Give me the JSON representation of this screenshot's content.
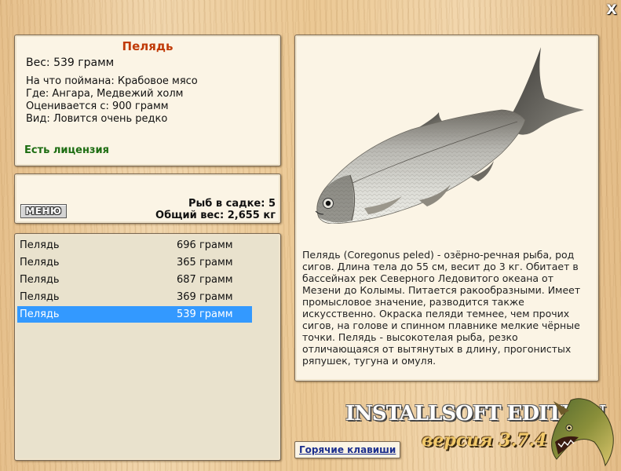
{
  "window": {
    "close_label": "X"
  },
  "fish_info": {
    "title": "Пелядь",
    "weight": "Вес: 539 грамм",
    "lines": [
      "На что поймана: Крабовое мясо",
      "Где: Ангара, Медвежий холм",
      "Оценивается с: 900 грамм",
      "Вид: Ловится очень редко"
    ],
    "license": "Есть лицензия",
    "license_color": "#1d6d12",
    "title_color": "#c03a08"
  },
  "keepnet": {
    "menu_label": "МЕНЮ",
    "count": "Рыб в садке: 5",
    "total": "Общий вес: 2,655 кг"
  },
  "catch_list": [
    {
      "name": "Пелядь",
      "weight": "696 грамм",
      "selected": false
    },
    {
      "name": "Пелядь",
      "weight": "365 грамм",
      "selected": false
    },
    {
      "name": "Пелядь",
      "weight": "687 грамм",
      "selected": false
    },
    {
      "name": "Пелядь",
      "weight": "369 грамм",
      "selected": false
    },
    {
      "name": "Пелядь",
      "weight": "539 грамм",
      "selected": true
    }
  ],
  "selection_color": "#3399ff",
  "description": "Пелядь (Coregonus peled) - озёрно-речная рыба, род сигов. Длина тела до 55 см, весит до 3 кг. Обитает в бассейнах рек Северного Ледовитого океана от Мезени до Колымы. Питается ракообразными. Имеет промысловое значение, разводится также искусственно. Окраска пеляди темнее, чем прочих сигов, на голове и спинном плавнике мелкие чёрные точки. Пелядь - высокотелая рыба, резко отличающаяся от вытянутых в длину, прогонистых ряпушек, тугуна и омуля.",
  "footer": {
    "hotkeys_label": "Горячие клавиши",
    "edition": "INSTALLSOFT EDITION",
    "version": "версия 3.7.4"
  },
  "icons": {
    "close": "close-icon",
    "fish_picture": "peled-fish-picture",
    "logo": "pike-logo-icon"
  }
}
